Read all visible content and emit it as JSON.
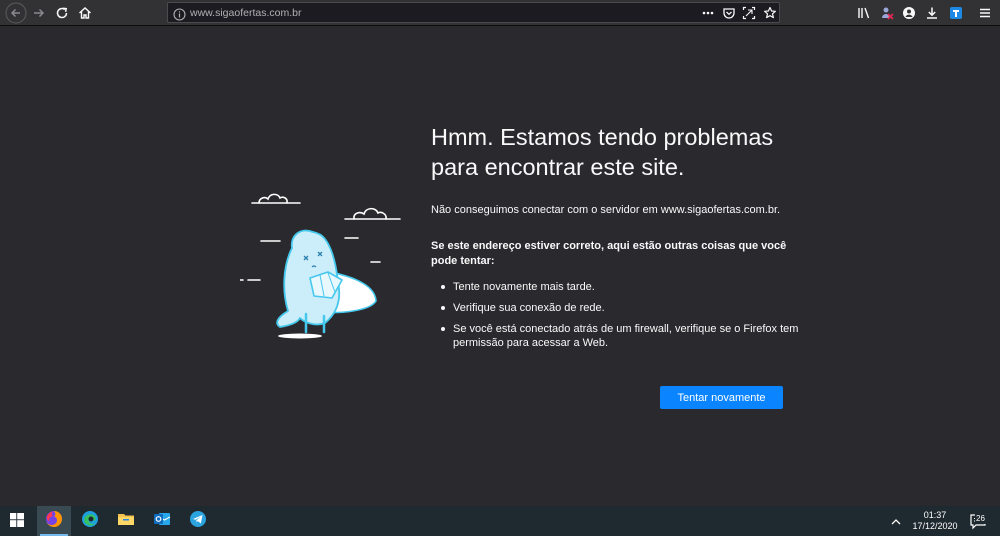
{
  "browser": {
    "url": "www.sigaofertas.com.br",
    "accent": "#0a84ff"
  },
  "error": {
    "title": "Hmm. Estamos tendo problemas para encontrar este site.",
    "description": "Não conseguimos conectar com o servidor em www.sigaofertas.com.br.",
    "suggestions_title": "Se este endereço estiver correto, aqui estão outras coisas que você pode tentar:",
    "suggestions": [
      "Tente novamente mais tarde.",
      "Verifique sua conexão de rede.",
      "Se você está conectado atrás de um firewall, verifique se o Firefox tem permissão para acessar a Web."
    ],
    "retry_label": "Tentar novamente"
  },
  "taskbar": {
    "time": "01:37",
    "date": "17/12/2020",
    "notification_count": "26",
    "apps": [
      "windows-start-icon",
      "firefox-icon",
      "edge-icon",
      "file-explorer-icon",
      "outlook-icon",
      "telegram-icon"
    ]
  }
}
